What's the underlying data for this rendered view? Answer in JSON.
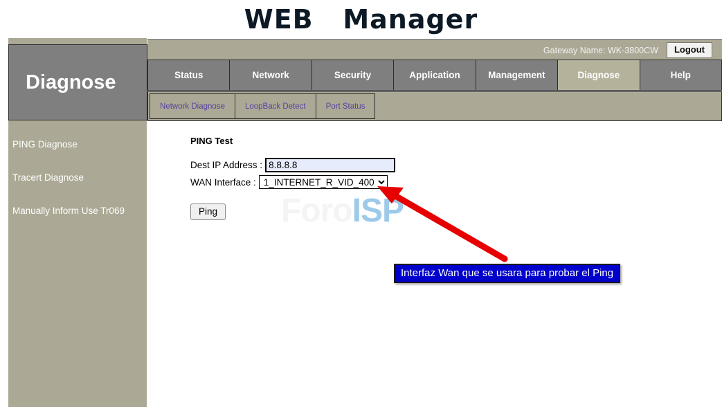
{
  "app": {
    "title": "WEB   Manager"
  },
  "header": {
    "gateway_label": "Gateway Name: WK-3800CW",
    "logout_label": "Logout"
  },
  "nav": {
    "tabs": [
      {
        "label": "Status",
        "active": false
      },
      {
        "label": "Network",
        "active": false
      },
      {
        "label": "Security",
        "active": false
      },
      {
        "label": "Application",
        "active": false
      },
      {
        "label": "Management",
        "active": false
      },
      {
        "label": "Diagnose",
        "active": true
      },
      {
        "label": "Help",
        "active": false
      }
    ]
  },
  "subnav": {
    "tabs": [
      {
        "label": "Network Diagnose"
      },
      {
        "label": "LoopBack Detect"
      },
      {
        "label": "Port Status"
      }
    ]
  },
  "sidebar": {
    "title": "Diagnose",
    "items": [
      {
        "label": "PING Diagnose"
      },
      {
        "label": "Tracert Diagnose"
      },
      {
        "label": "Manually Inform Use Tr069"
      }
    ]
  },
  "main": {
    "section_title": "PING Test",
    "dest_ip": {
      "label": "Dest IP Address :",
      "value": "8.8.8.8",
      "placeholder": ""
    },
    "wan_interface": {
      "label": "WAN Interface :",
      "selected": "1_INTERNET_R_VID_400",
      "options": [
        "1_INTERNET_R_VID_400"
      ]
    },
    "ping_button": "Ping"
  },
  "watermark": {
    "part1": "Foro",
    "part2": "ISP"
  },
  "annotation": {
    "callout_text": "Interfaz Wan que se usara para probar el Ping",
    "arrow_color": "#e60000",
    "callout_bg": "#0000cd"
  }
}
